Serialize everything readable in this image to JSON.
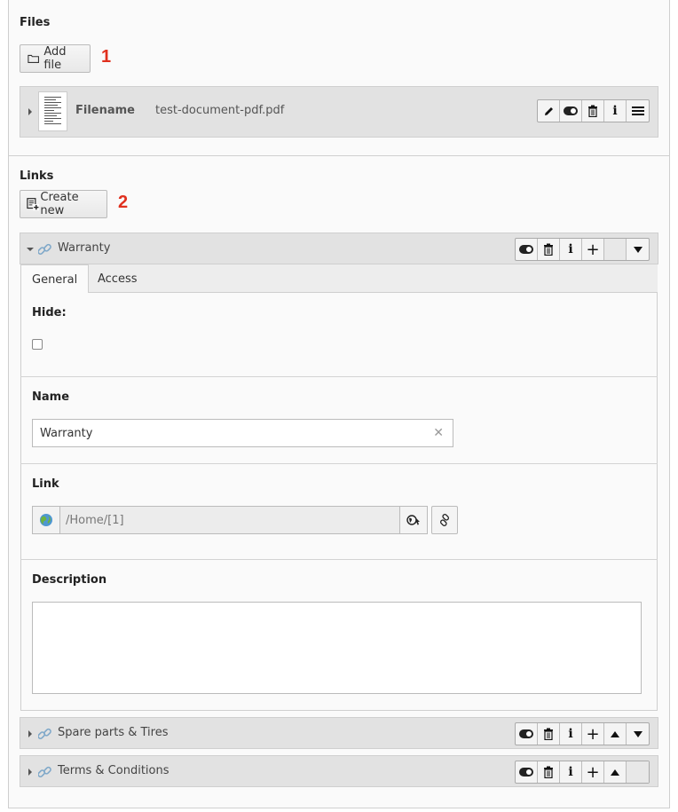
{
  "files": {
    "title": "Files",
    "add_label": "Add file",
    "marker": "1",
    "row": {
      "label": "Filename",
      "value": "test-document-pdf.pdf"
    }
  },
  "links": {
    "title": "Links",
    "create_label": "Create new",
    "marker": "2",
    "records": [
      {
        "title": "Warranty"
      },
      {
        "title": "Spare parts & Tires"
      },
      {
        "title": "Terms & Conditions"
      }
    ]
  },
  "tabs": [
    "General",
    "Access"
  ],
  "form": {
    "hide_label": "Hide:",
    "name_label": "Name",
    "name_value": "Warranty",
    "link_label": "Link",
    "link_value": "/Home/[1]",
    "description_label": "Description",
    "description_value": ""
  },
  "icons": {
    "add_file": "folder-icon",
    "create_new": "new-record-icon",
    "edit": "pencil-icon",
    "hide_toggle": "toggle-icon",
    "delete": "trash-icon",
    "info": "info-icon",
    "new_after": "plus-icon",
    "drag": "drag-handle-icon",
    "move_up": "arrow-up-icon",
    "move_down": "arrow-down-icon",
    "record": "link-chain-icon",
    "page_tree": "globe-icon",
    "link_browser": "link-icon"
  },
  "colors": {
    "marker": "#e0301e",
    "header_bg": "#e2e2e2",
    "panel_bg": "#fafafa"
  }
}
